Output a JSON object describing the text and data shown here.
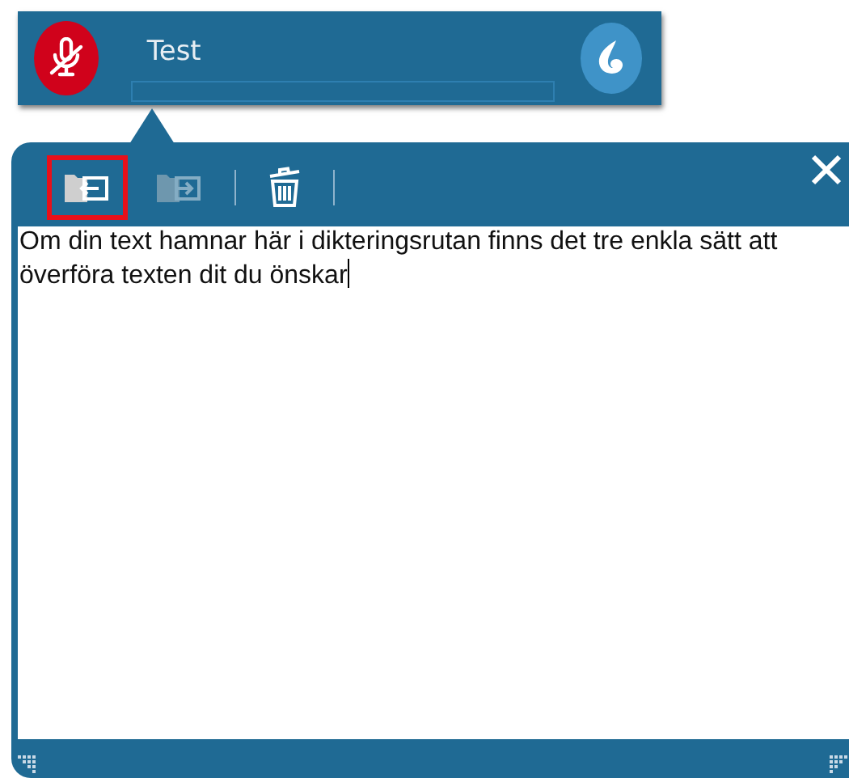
{
  "dictation_bar": {
    "title": "Test",
    "mic_muted": true
  },
  "toolbar": [
    {
      "kind": "transfer-in",
      "disabled": false,
      "highlighted": true
    },
    {
      "kind": "transfer-out",
      "disabled": true,
      "highlighted": false
    },
    {
      "kind": "delete",
      "disabled": false,
      "highlighted": false
    }
  ],
  "dictation_box": {
    "value": "Om din text hamnar här i dikteringsrutan finns det tre enkla sätt att överföra texten dit du önskar"
  }
}
